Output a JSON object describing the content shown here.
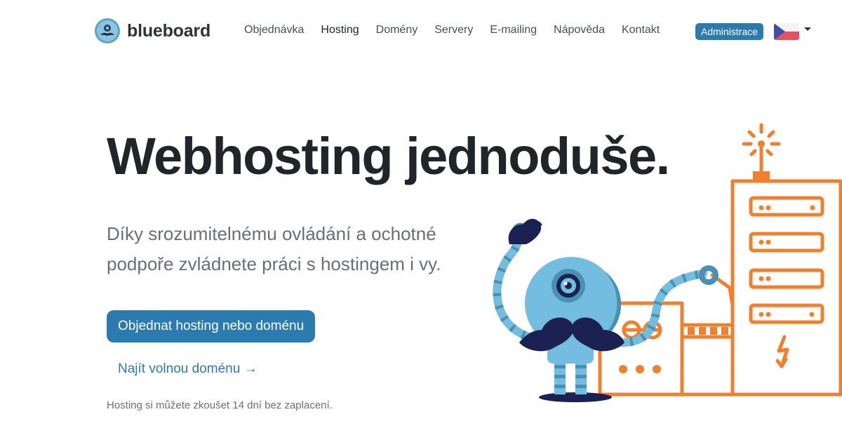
{
  "header": {
    "brand": {
      "name": "blueboard",
      "logo_icon": "mustache-robot-logo-icon"
    },
    "nav": [
      {
        "label": "Objednávka",
        "active": false
      },
      {
        "label": "Hosting",
        "active": true
      },
      {
        "label": "Domény",
        "active": false
      },
      {
        "label": "Servery",
        "active": false
      },
      {
        "label": "E-mailing",
        "active": false
      },
      {
        "label": "Nápověda",
        "active": false
      },
      {
        "label": "Kontakt",
        "active": false
      }
    ],
    "admin_label": "Administrace",
    "language": {
      "selected": "cs",
      "flag_icon": "czech-flag-icon"
    }
  },
  "hero": {
    "title": "Webhosting jednoduše.",
    "lead": "Díky srozumitelnému ovládání a ochotné podpoře zvládnete práci s hostingem i vy.",
    "cta_label": "Objednat hosting nebo doménu",
    "find_domain_label": "Najít volnou doménu",
    "find_domain_arrow": "→",
    "trial_note": "Hosting si můžete zkoušet 14 dní bez zaplacení."
  },
  "colors": {
    "brand_blue": "#2c7bb0",
    "text_dark": "#212529",
    "text_muted": "#6b6f75",
    "illustration_orange": "#f07f2e",
    "robot_light": "#72bde0",
    "robot_mid": "#4a8fb4",
    "robot_dark": "#1b2152"
  }
}
